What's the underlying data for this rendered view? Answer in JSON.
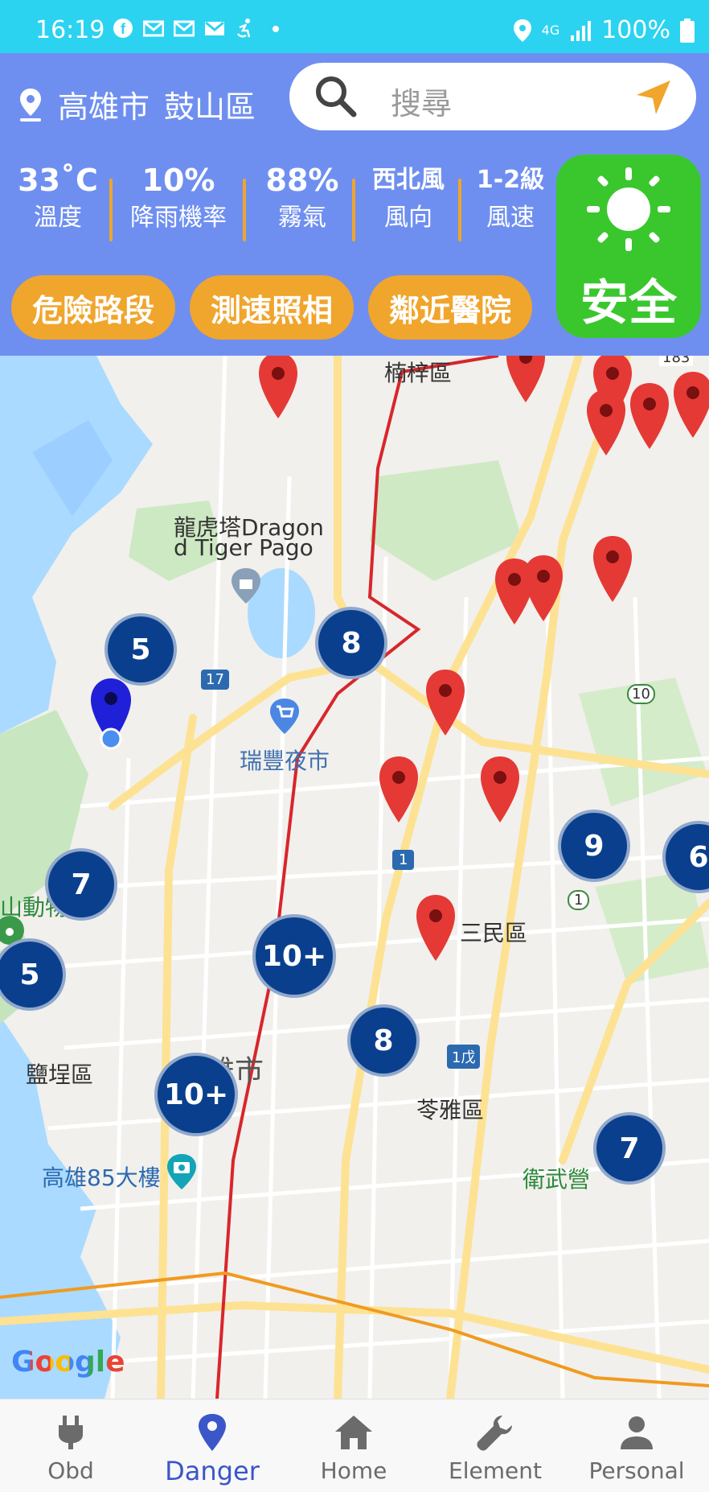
{
  "status_bar": {
    "time": "16:19",
    "network": "4G",
    "battery": "100%",
    "left_icons": [
      "facebook-icon",
      "mail-icon",
      "mail-icon",
      "mail-icon",
      "accessibility-icon",
      "dot-icon"
    ],
    "right_icons": [
      "location-icon",
      "signal-icon",
      "battery-icon"
    ]
  },
  "header": {
    "city": "高雄市",
    "district": "鼓山區",
    "search_placeholder": "搜尋",
    "stats": [
      {
        "value": "33˚C",
        "label": "溫度"
      },
      {
        "value": "10%",
        "label": "降雨機率"
      },
      {
        "value": "88%",
        "label": "霧氣"
      },
      {
        "value": "西北風",
        "label": "風向"
      },
      {
        "value": "1-2級",
        "label": "風速"
      }
    ],
    "safety_status": "安全",
    "buttons": [
      "危險路段",
      "測速照相",
      "鄰近醫院"
    ],
    "colors": {
      "panel": "#6f8ff0",
      "accent": "#f0a52c",
      "safe": "#3ac72d",
      "status_bar": "#2bd3f0"
    }
  },
  "map": {
    "labels": {
      "nanzi": "楠梓區",
      "dragon_tiger": "龍虎塔Dragon",
      "dragon_tiger_2": "d Tiger Pago",
      "ruifeng": "瑞豐夜市",
      "sanmin": "三民區",
      "zoo": "山動物園",
      "yancheng": "鹽埕區",
      "kaohsiung": "高雄市",
      "lingya": "苓雅區",
      "tower85": "高雄85大樓",
      "weiwuying": "衛武營",
      "road_183": "183",
      "road_17": "17",
      "road_10": "10",
      "road_1": "1",
      "road_1_2": "1",
      "road_1wu": "1戊"
    },
    "clusters": [
      "5",
      "8",
      "7",
      "10+",
      "6",
      "9",
      "5",
      "8",
      "10+",
      "7"
    ],
    "google_logo": "Google"
  },
  "bottom_nav": {
    "items": [
      {
        "label": "Obd",
        "icon": "plug-icon"
      },
      {
        "label": "Danger",
        "icon": "map-pin-icon"
      },
      {
        "label": "Home",
        "icon": "home-icon"
      },
      {
        "label": "Element",
        "icon": "wrench-icon"
      },
      {
        "label": "Personal",
        "icon": "person-icon"
      }
    ],
    "active": "Danger"
  }
}
